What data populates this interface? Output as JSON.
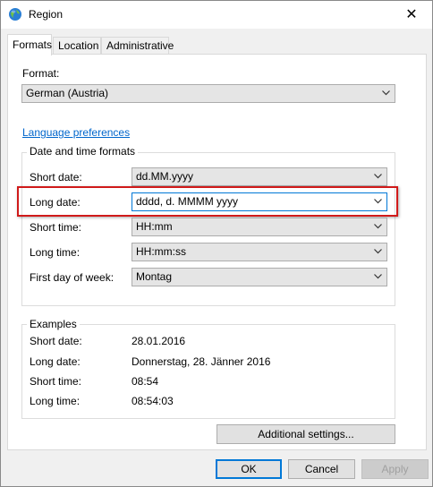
{
  "window": {
    "title": "Region",
    "close_glyph": "✕",
    "icon": "globe-icon"
  },
  "tabs": [
    {
      "label": "Formats",
      "active": true
    },
    {
      "label": "Location",
      "active": false
    },
    {
      "label": "Administrative",
      "active": false
    }
  ],
  "format": {
    "label": "Format:",
    "value": "German (Austria)"
  },
  "language_link": "Language preferences",
  "date_time": {
    "group_title": "Date and time formats",
    "rows": [
      {
        "label": "Short date:",
        "value": "dd.MM.yyyy"
      },
      {
        "label": "Long date:",
        "value": "dddd, d. MMMM yyyy",
        "highlighted": true
      },
      {
        "label": "Short time:",
        "value": "HH:mm"
      },
      {
        "label": "Long time:",
        "value": "HH:mm:ss"
      },
      {
        "label": "First day of week:",
        "value": "Montag"
      }
    ]
  },
  "examples": {
    "group_title": "Examples",
    "rows": [
      {
        "label": "Short date:",
        "value": "28.01.2016"
      },
      {
        "label": "Long date:",
        "value": "Donnerstag, 28. Jänner 2016"
      },
      {
        "label": "Short time:",
        "value": "08:54"
      },
      {
        "label": "Long time:",
        "value": "08:54:03"
      }
    ]
  },
  "buttons": {
    "additional": "Additional settings...",
    "ok": "OK",
    "cancel": "Cancel",
    "apply": "Apply"
  },
  "colors": {
    "accent": "#0078d7",
    "link": "#0066cc",
    "highlight_border": "#d01a1a"
  }
}
